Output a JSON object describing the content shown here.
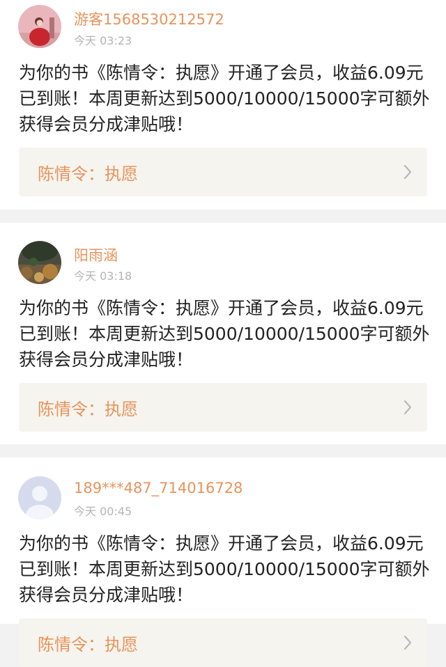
{
  "notifications": [
    {
      "username": "游客1568530212572",
      "time": "今天 03:23",
      "message_lines": [
        "为你的书《陈情令：执愿》开通了会员，收益6.09元",
        "已到账！本周更新达到5000/10000/15000字可额外",
        "获得会员分成津贴哦！"
      ],
      "book_title": "陈情令：执愿"
    },
    {
      "username": "阳雨涵",
      "time": "今天 03:18",
      "message_lines": [
        "为你的书《陈情令：执愿》开通了会员，收益6.09元",
        "已到账！本周更新达到5000/10000/15000字可额外",
        "获得会员分成津贴哦！"
      ],
      "book_title": "陈情令：执愿"
    },
    {
      "username": "189***487_714016728",
      "time": "今天 00:45",
      "message_lines": [
        "为你的书《陈情令：执愿》开通了会员，收益6.09元",
        "已到账！本周更新达到5000/10000/15000字可额外",
        "获得会员分成津贴哦！"
      ],
      "book_title": "陈情令：执愿"
    }
  ],
  "colors": {
    "accent": "#e8935c",
    "time": "#b4b4b4",
    "text": "#222222",
    "link_bg": "#f6f4ee",
    "page_bg": "#f2f2f2"
  }
}
